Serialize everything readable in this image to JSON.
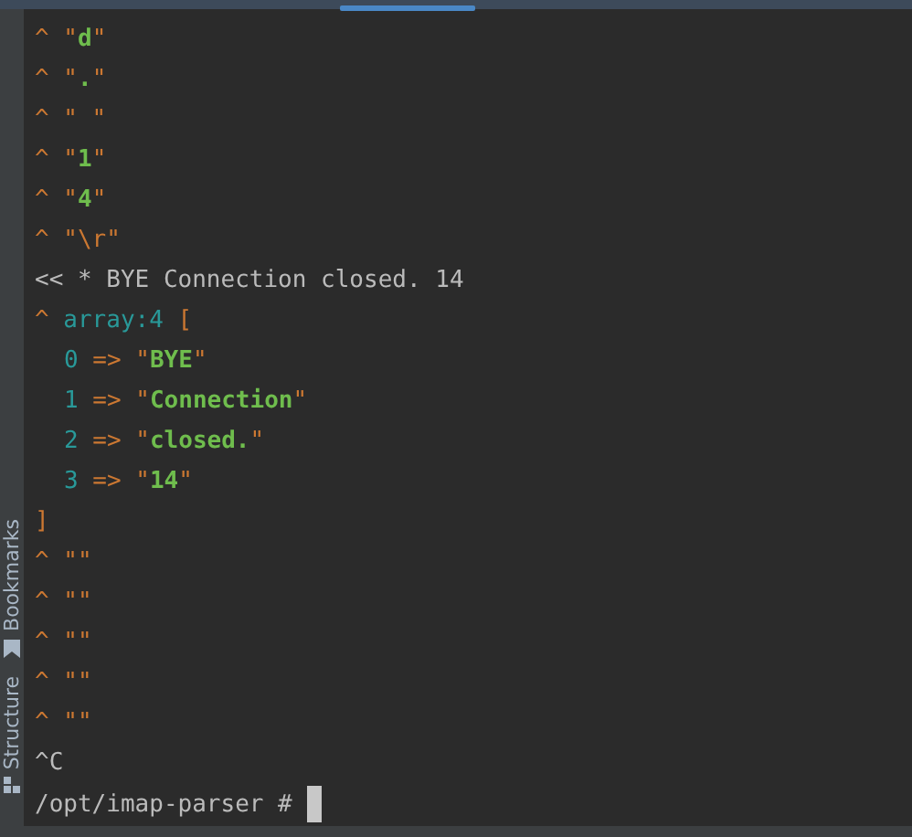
{
  "sidebar": {
    "tabs": [
      {
        "label": "Bookmarks"
      },
      {
        "label": "Structure"
      }
    ]
  },
  "terminal": {
    "lines": [
      {
        "kind": "top",
        "parts": [
          {
            "text": "^ ",
            "kind": "caret"
          },
          {
            "text": "\"",
            "kind": "quote"
          },
          {
            "text": "d",
            "kind": "str"
          },
          {
            "text": "\"",
            "kind": "quote"
          }
        ]
      },
      {
        "kind": "top",
        "parts": [
          {
            "text": "^ ",
            "kind": "caret"
          },
          {
            "text": "\"",
            "kind": "quote"
          },
          {
            "text": ".",
            "kind": "str"
          },
          {
            "text": "\"",
            "kind": "quote"
          }
        ]
      },
      {
        "kind": "top",
        "parts": [
          {
            "text": "^ ",
            "kind": "caret"
          },
          {
            "text": "\" \"",
            "kind": "quote"
          }
        ]
      },
      {
        "kind": "top",
        "parts": [
          {
            "text": "^ ",
            "kind": "caret"
          },
          {
            "text": "\"",
            "kind": "quote"
          },
          {
            "text": "1",
            "kind": "str"
          },
          {
            "text": "\"",
            "kind": "quote"
          }
        ]
      },
      {
        "kind": "top",
        "parts": [
          {
            "text": "^ ",
            "kind": "caret"
          },
          {
            "text": "\"",
            "kind": "quote"
          },
          {
            "text": "4",
            "kind": "str"
          },
          {
            "text": "\"",
            "kind": "quote"
          }
        ]
      },
      {
        "kind": "top",
        "parts": [
          {
            "text": "^ ",
            "kind": "caret"
          },
          {
            "text": "\"\\r\"",
            "kind": "quote"
          }
        ]
      },
      {
        "kind": "top",
        "parts": [
          {
            "text": "<< * BYE Connection closed. 14",
            "kind": "plain"
          }
        ]
      },
      {
        "kind": "top",
        "parts": [
          {
            "text": "^ ",
            "kind": "caret"
          },
          {
            "text": "array:4",
            "kind": "key"
          },
          {
            "text": " [",
            "kind": "quote"
          }
        ]
      },
      {
        "kind": "entry",
        "parts": [
          {
            "text": "0",
            "kind": "key"
          },
          {
            "text": " => ",
            "kind": "quote"
          },
          {
            "text": "\"",
            "kind": "quote"
          },
          {
            "text": "BYE",
            "kind": "str"
          },
          {
            "text": "\"",
            "kind": "quote"
          }
        ]
      },
      {
        "kind": "entry",
        "parts": [
          {
            "text": "1",
            "kind": "key"
          },
          {
            "text": " => ",
            "kind": "quote"
          },
          {
            "text": "\"",
            "kind": "quote"
          },
          {
            "text": "Connection",
            "kind": "str"
          },
          {
            "text": "\"",
            "kind": "quote"
          }
        ]
      },
      {
        "kind": "entry",
        "parts": [
          {
            "text": "2",
            "kind": "key"
          },
          {
            "text": " => ",
            "kind": "quote"
          },
          {
            "text": "\"",
            "kind": "quote"
          },
          {
            "text": "closed.",
            "kind": "str"
          },
          {
            "text": "\"",
            "kind": "quote"
          }
        ]
      },
      {
        "kind": "entry",
        "parts": [
          {
            "text": "3",
            "kind": "key"
          },
          {
            "text": " => ",
            "kind": "quote"
          },
          {
            "text": "\"",
            "kind": "quote"
          },
          {
            "text": "14",
            "kind": "str"
          },
          {
            "text": "\"",
            "kind": "quote"
          }
        ]
      },
      {
        "kind": "top",
        "parts": [
          {
            "text": "]",
            "kind": "quote"
          }
        ]
      },
      {
        "kind": "top",
        "parts": [
          {
            "text": "^ ",
            "kind": "caret"
          },
          {
            "text": "\"\"",
            "kind": "quote"
          }
        ]
      },
      {
        "kind": "top",
        "parts": [
          {
            "text": "^ ",
            "kind": "caret"
          },
          {
            "text": "\"\"",
            "kind": "quote"
          }
        ]
      },
      {
        "kind": "top",
        "parts": [
          {
            "text": "^ ",
            "kind": "caret"
          },
          {
            "text": "\"\"",
            "kind": "quote"
          }
        ]
      },
      {
        "kind": "top",
        "parts": [
          {
            "text": "^ ",
            "kind": "caret"
          },
          {
            "text": "\"\"",
            "kind": "quote"
          }
        ]
      },
      {
        "kind": "top",
        "parts": [
          {
            "text": "^ ",
            "kind": "caret"
          },
          {
            "text": "\"\"",
            "kind": "quote"
          }
        ]
      },
      {
        "kind": "top",
        "parts": [
          {
            "text": "^C",
            "kind": "plain"
          }
        ]
      }
    ],
    "prompt": "/opt/imap-parser #"
  }
}
